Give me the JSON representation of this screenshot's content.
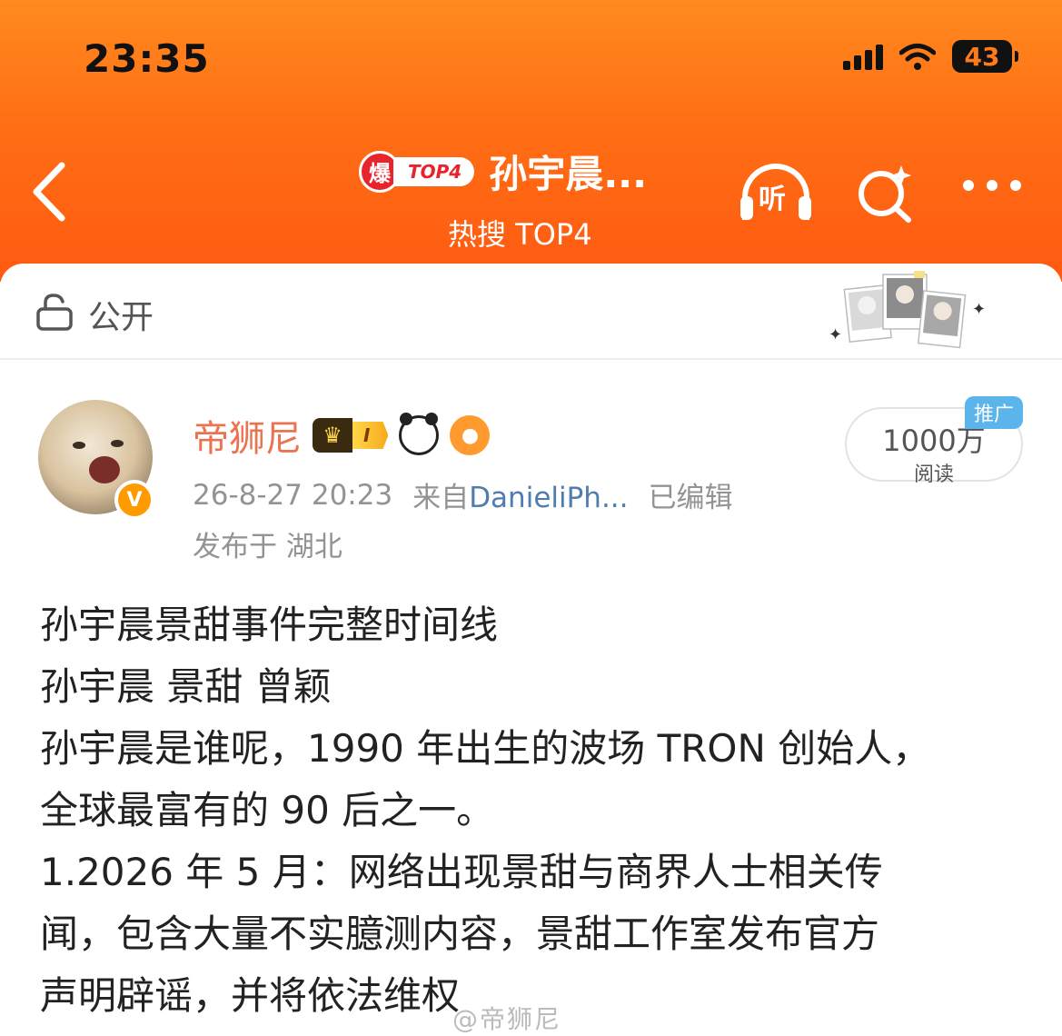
{
  "status_bar": {
    "time": "23:35",
    "battery": "43"
  },
  "nav": {
    "hot_badge_icon": "爆",
    "hot_rank_label": "TOP4",
    "title": "孙宇晨...",
    "subtitle": "热搜 TOP4",
    "listen_label": "听"
  },
  "visibility": {
    "label": "公开"
  },
  "post": {
    "username": "帝狮尼",
    "level_label": "I",
    "timestamp": "26-8-27 20:23",
    "source_prefix": "来自",
    "source_name": "DanieliPh...",
    "edited": "已编辑",
    "location": "发布于 湖北",
    "reads_count": "1000万",
    "reads_label": "阅读",
    "promo_label": "推广",
    "lines": [
      "孙宇晨景甜事件完整时间线",
      "孙宇晨 景甜 曾颖",
      "孙宇晨是谁呢，1990 年出生的波场 TRON 创始人，",
      "全球最富有的 90 后之一。",
      "1.2026 年 5 月：网络出现景甜与商界人士相关传",
      "闻，包含大量不实臆测内容，景甜工作室发布官方",
      "声明辟谣，并将依法维权"
    ],
    "watermark": "@帝狮尼"
  },
  "colors": {
    "header_orange": "#ff6e14",
    "username": "#eb7350",
    "link": "#507daf",
    "promo": "#5bb4ea"
  },
  "icons": [
    "back-arrow-icon",
    "listen-icon",
    "search-icon",
    "more-icon",
    "lock-icon",
    "vip-icon",
    "crown-icon",
    "panda-icon",
    "fish-icon"
  ]
}
